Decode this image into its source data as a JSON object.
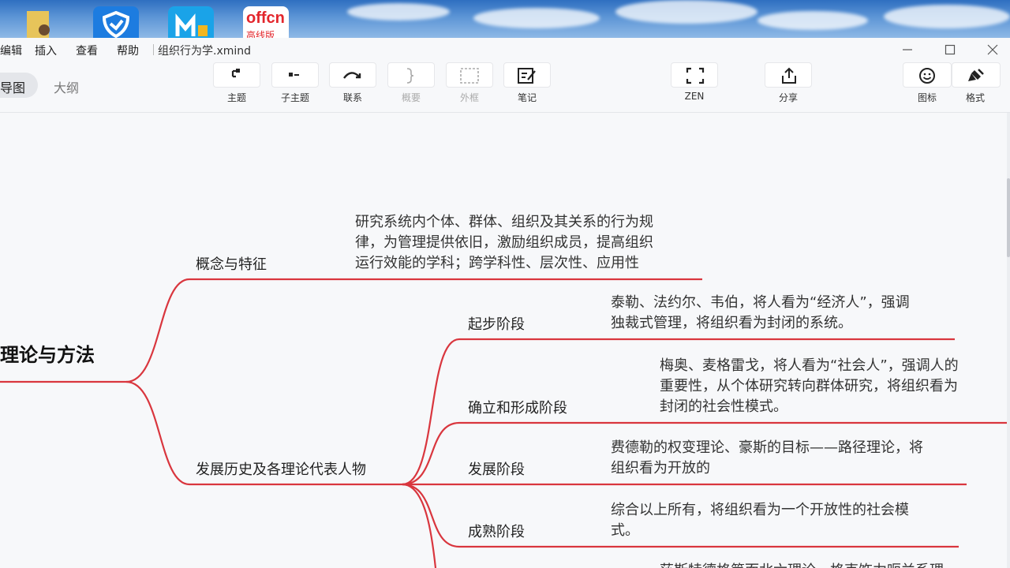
{
  "desktop": {
    "icons": [
      "folder-user-icon",
      "security-app-icon",
      "messenger-app-icon",
      "offcn-app-icon"
    ],
    "offcn_text": "offcn",
    "offcn_sub": "高线版"
  },
  "window": {
    "menus": [
      "编辑",
      "插入",
      "查看",
      "帮助"
    ],
    "filename": "组织行为学.xmind",
    "controls": [
      "minimize-icon",
      "maximize-icon",
      "close-icon"
    ]
  },
  "views": {
    "mindmap": "导图",
    "outline": "大纲"
  },
  "toolbar": {
    "topic": "主题",
    "subtopic": "子主题",
    "relation": "联系",
    "summary": "概要",
    "boundary": "外框",
    "note": "笔记",
    "zen": "ZEN",
    "share": "分享",
    "icon": "图标",
    "format": "格式"
  },
  "mindmap": {
    "central": "理论与方法",
    "branch1": {
      "label": "概念与特征",
      "note": [
        "研究系统内个体、群体、组织及其关系的行为规",
        "律，为管理提供依旧，激励组织成员，提高组织",
        "运行效能的学科；跨学科性、层次性、应用性"
      ]
    },
    "branch2": {
      "label": "发展历史及各理论代表人物",
      "children": [
        {
          "label": "起步阶段",
          "note": [
            "泰勒、法约尔、韦伯，将人看为“经济人”，强调",
            "独裁式管理，将组织看为封闭的系统。"
          ]
        },
        {
          "label": "确立和形成阶段",
          "note": [
            "梅奥、麦格雷戈，将人看为“社会人”，强调人的",
            "重要性，从个体研究转向群体研究，将组织看为",
            "封闭的社会性模式。"
          ]
        },
        {
          "label": "发展阶段",
          "note": [
            "费德勒的权变理论、豪斯的目标——路径理论，将",
            "组织看为开放的"
          ]
        },
        {
          "label": "成熟阶段",
          "note": [
            "综合以上所有，将组织看为一个开放性的社会模",
            "式。"
          ]
        }
      ]
    },
    "partial_note": "莎斯特德格第而北六理论，格克饰力呃兰系理"
  },
  "colors": {
    "branch_line": "#d9363e",
    "canvas": "#f7f8fa"
  }
}
